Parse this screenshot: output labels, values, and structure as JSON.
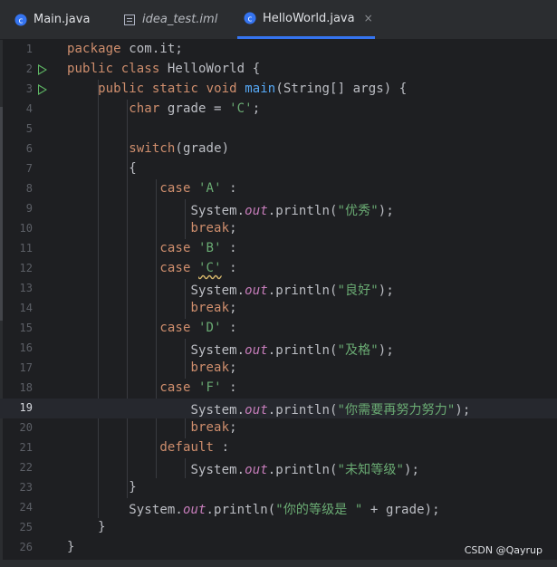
{
  "tabs": [
    {
      "label": "Main.java",
      "icon": "java-class-icon",
      "active": false
    },
    {
      "label": "idea_test.iml",
      "icon": "module-file-icon",
      "active": false
    },
    {
      "label": "HelloWorld.java",
      "icon": "java-class-icon",
      "active": true,
      "close": "×"
    }
  ],
  "lines": [
    {
      "n": "1",
      "text": "package com.it;"
    },
    {
      "n": "2",
      "text": "public class HelloWorld {",
      "run": true
    },
    {
      "n": "3",
      "text": "    public static void main(String[] args) {",
      "run": true
    },
    {
      "n": "4",
      "text": "        char grade = 'C';"
    },
    {
      "n": "5",
      "text": ""
    },
    {
      "n": "6",
      "text": "        switch(grade)"
    },
    {
      "n": "7",
      "text": "        {"
    },
    {
      "n": "8",
      "text": "            case 'A' :"
    },
    {
      "n": "9",
      "text": "                System.out.println(\"优秀\");"
    },
    {
      "n": "10",
      "text": "                break;"
    },
    {
      "n": "11",
      "text": "            case 'B' :"
    },
    {
      "n": "12",
      "text": "            case 'C' :"
    },
    {
      "n": "13",
      "text": "                System.out.println(\"良好\");"
    },
    {
      "n": "14",
      "text": "                break;"
    },
    {
      "n": "15",
      "text": "            case 'D' :"
    },
    {
      "n": "16",
      "text": "                System.out.println(\"及格\");"
    },
    {
      "n": "17",
      "text": "                break;"
    },
    {
      "n": "18",
      "text": "            case 'F' :"
    },
    {
      "n": "19",
      "text": "                System.out.println(\"你需要再努力努力\");",
      "current": true
    },
    {
      "n": "20",
      "text": "                break;"
    },
    {
      "n": "21",
      "text": "            default :"
    },
    {
      "n": "22",
      "text": "                System.out.println(\"未知等级\");"
    },
    {
      "n": "23",
      "text": "        }"
    },
    {
      "n": "24",
      "text": "        System.out.println(\"你的等级是 \" + grade);"
    },
    {
      "n": "25",
      "text": "    }"
    },
    {
      "n": "26",
      "text": "}"
    }
  ],
  "watermark": "CSDN @Qayrup",
  "colors": {
    "keyword": "#cf8e6d",
    "string": "#6aab73",
    "method": "#56a8f5",
    "field": "#c77dbb",
    "run_gutter": "#5fb865",
    "active_tab_underline": "#3574f0"
  }
}
